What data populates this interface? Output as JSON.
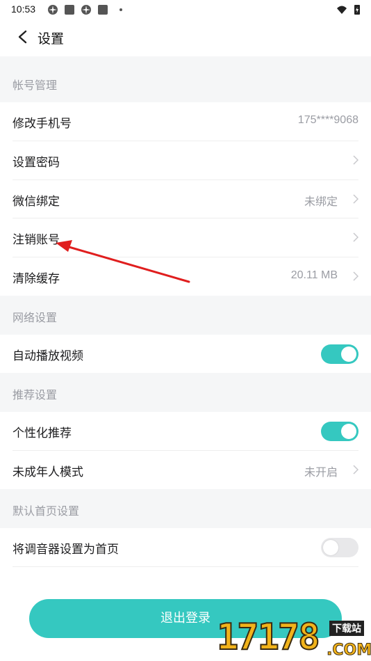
{
  "status_bar": {
    "time": "10:53"
  },
  "header": {
    "title": "设置"
  },
  "sections": {
    "account": "帐号管理",
    "network": "网络设置",
    "recommend": "推荐设置",
    "homepage": "默认首页设置"
  },
  "rows": {
    "change_phone": {
      "label": "修改手机号",
      "value": "175****9068"
    },
    "set_password": {
      "label": "设置密码"
    },
    "wechat_bind": {
      "label": "微信绑定",
      "value": "未绑定"
    },
    "cancel_account": {
      "label": "注销账号"
    },
    "clear_cache": {
      "label": "清除缓存",
      "value": "20.11 MB"
    },
    "autoplay_video": {
      "label": "自动播放视频",
      "toggle": true
    },
    "personalized": {
      "label": "个性化推荐",
      "toggle": true
    },
    "minor_mode": {
      "label": "未成年人模式",
      "value": "未开启"
    },
    "tuner_home": {
      "label": "将调音器设置为首页",
      "toggle": false
    }
  },
  "logout_label": "退出登录",
  "watermark": {
    "digits": "17178",
    "tag": "下载站",
    "domain": ".COM"
  },
  "colors": {
    "accent": "#35c8c0",
    "section_bg": "#f5f6f7",
    "annotation_arrow": "#e01e1e"
  }
}
